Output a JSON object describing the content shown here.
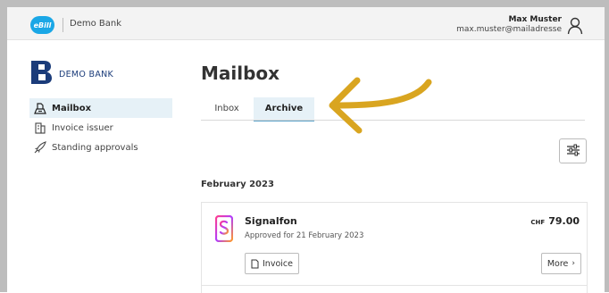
{
  "topbar": {
    "logo_text": "eBill",
    "bank_name": "Demo Bank",
    "user_name": "Max Muster",
    "user_email": "max.muster@mailadresse"
  },
  "sidebar": {
    "bank_logo_text": "DEMO BANK",
    "items": [
      {
        "label": "Mailbox",
        "icon": "mailbox-icon",
        "active": true
      },
      {
        "label": "Invoice issuer",
        "icon": "building-icon",
        "active": false
      },
      {
        "label": "Standing approvals",
        "icon": "rocket-icon",
        "active": false
      }
    ]
  },
  "main": {
    "title": "Mailbox",
    "tabs": [
      {
        "label": "Inbox",
        "active": false
      },
      {
        "label": "Archive",
        "active": true
      }
    ],
    "filter_icon": "sliders-icon",
    "month_heading": "February 2023",
    "cards": [
      {
        "title": "Signalfon",
        "subtitle": "Approved for 21 February 2023",
        "currency": "CHF",
        "amount": "79.00",
        "invoice_label": "Invoice",
        "more_label": "More"
      }
    ]
  },
  "colors": {
    "accent": "#1aa7e6",
    "tab_active_bg": "#e6f1f7",
    "arrow": "#d9a520",
    "bank_blue": "#1b3c7a"
  }
}
